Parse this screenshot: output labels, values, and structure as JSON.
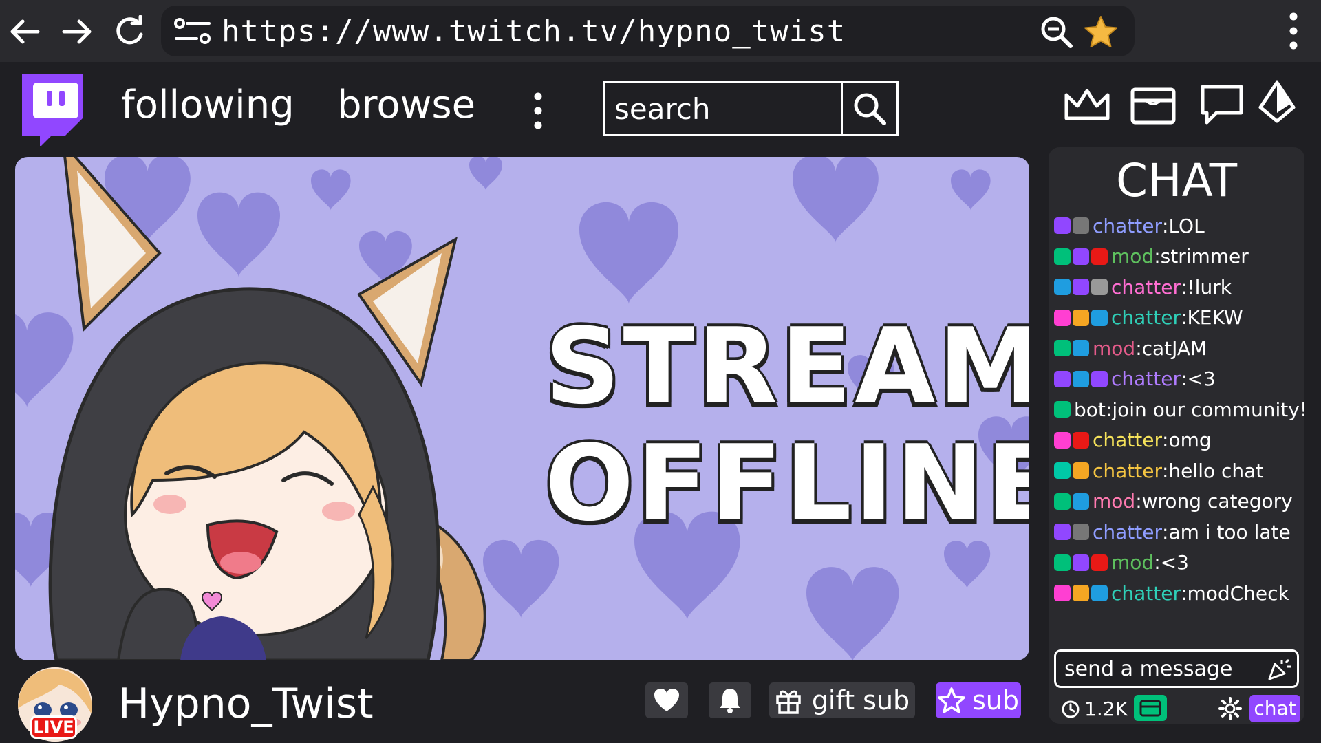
{
  "browser": {
    "url": "https://www.twitch.tv/hypno_twist",
    "back_icon": "back-arrow-icon",
    "forward_icon": "forward-arrow-icon",
    "reload_icon": "reload-icon"
  },
  "header": {
    "nav": [
      "following",
      "browse"
    ],
    "search_placeholder": "search"
  },
  "player": {
    "line1": "STREAM",
    "line2": "OFFLINE",
    "background_color": "#b5b0ec",
    "heart_color": "#8a82d8"
  },
  "channel": {
    "name": "Hypno_Twist",
    "live_label": "LIVE",
    "gift_label": "gift sub",
    "sub_label": "sub"
  },
  "chat": {
    "title": "CHAT",
    "messages": [
      {
        "badges": [
          "#9147ff",
          "#777"
        ],
        "user": "chatter",
        "color": "#8f9dff",
        "text": "LOL"
      },
      {
        "badges": [
          "#00c07a",
          "#9147ff",
          "#e91916"
        ],
        "user": "mod",
        "color": "#5ec05e",
        "text": "strimmer"
      },
      {
        "badges": [
          "#1f9de0",
          "#9147ff",
          "#999"
        ],
        "user": "chatter",
        "color": "#ff6ed2",
        "text": "!lurk"
      },
      {
        "badges": [
          "#ff3fd2",
          "#f5a623",
          "#1f9de0"
        ],
        "user": "chatter",
        "color": "#2fd0b8",
        "text": "KEKW"
      },
      {
        "badges": [
          "#00c07a",
          "#1f9de0"
        ],
        "user": "mod",
        "color": "#e45b8a",
        "text": "catJAM"
      },
      {
        "badges": [
          "#9147ff",
          "#1f9de0",
          "#9147ff"
        ],
        "user": "chatter",
        "color": "#b07cff",
        "text": "<3"
      },
      {
        "badges": [
          "#00c07a"
        ],
        "user": "bot",
        "color": "#ffffff",
        "text": "join our community!"
      },
      {
        "badges": [
          "#ff3fd2",
          "#e91916"
        ],
        "user": "chatter",
        "color": "#f5e25a",
        "text": "omg"
      },
      {
        "badges": [
          "#00c9a7",
          "#f5a623"
        ],
        "user": "chatter",
        "color": "#f5c542",
        "text": "hello chat"
      },
      {
        "badges": [
          "#00c07a",
          "#1f9de0"
        ],
        "user": "mod",
        "color": "#ff7ab0",
        "text": "wrong category"
      },
      {
        "badges": [
          "#9147ff",
          "#777"
        ],
        "user": "chatter",
        "color": "#8f9dff",
        "text": "am i too late"
      },
      {
        "badges": [
          "#00c07a",
          "#9147ff",
          "#e91916"
        ],
        "user": "mod",
        "color": "#5ec05e",
        "text": "<3"
      },
      {
        "badges": [
          "#ff3fd2",
          "#f5a623",
          "#1f9de0"
        ],
        "user": "chatter",
        "color": "#2fd0b8",
        "text": "modCheck"
      }
    ],
    "input_placeholder": "send a message",
    "viewers": "1.2K",
    "chat_button": "chat"
  }
}
